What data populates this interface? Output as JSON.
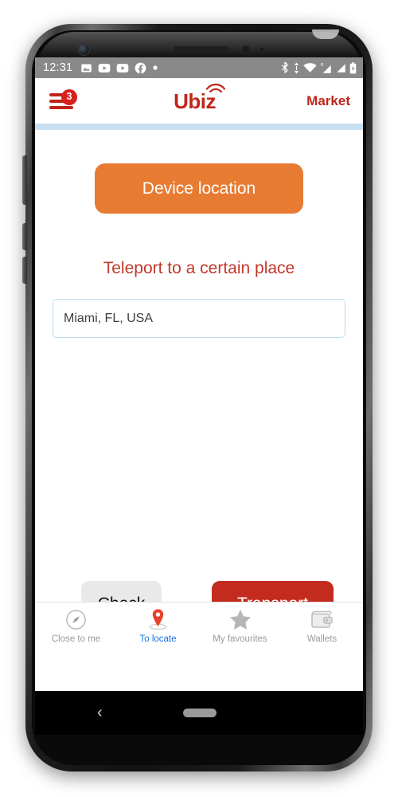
{
  "status_bar": {
    "time": "12:31",
    "left_icons": [
      "photos-icon",
      "youtube-icon",
      "youtube-icon",
      "facebook-icon",
      "dot-icon"
    ],
    "right_icons": [
      "bluetooth-icon",
      "data-transfer-icon",
      "wifi-icon",
      "roaming-signal-icon",
      "cellular-signal-icon",
      "battery-icon"
    ],
    "background_color": "#898989"
  },
  "header": {
    "menu_badge_count": "3",
    "brand": "Ubiz",
    "market_label": "Market",
    "brand_color": "#c0251b",
    "rule_color": "#c7e0f4"
  },
  "main": {
    "device_location_label": "Device location",
    "device_location_color": "#e87b32",
    "section_title": "Teleport to a certain place",
    "section_title_color": "#c0392b",
    "place_input": {
      "value": "Miami, FL, USA",
      "placeholder": "Miami, FL, USA",
      "border_color": "#bcdcf2"
    },
    "check_label": "Check",
    "check_color": "#e9e9e9",
    "transport_label": "Transport",
    "transport_color": "#c42b1f"
  },
  "tabbar": {
    "active_color": "#1a73e8",
    "inactive_color": "#9a9a9a",
    "items": [
      {
        "label": "Close to me",
        "icon": "compass-icon",
        "active": false
      },
      {
        "label": "To locate",
        "icon": "map-pin-icon",
        "active": true
      },
      {
        "label": "My favourites",
        "icon": "star-icon",
        "active": false
      },
      {
        "label": "Wallets",
        "icon": "wallet-icon",
        "active": false
      }
    ]
  },
  "system_nav": {
    "back_glyph": "‹",
    "home_indicator": "home-pill"
  }
}
